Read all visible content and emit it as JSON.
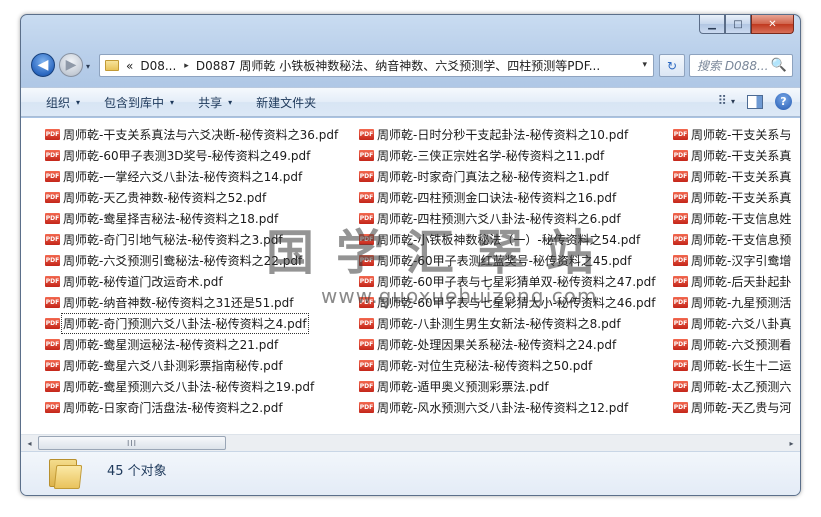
{
  "window": {
    "min_label": "▁",
    "max_label": "□",
    "close_label": "✕"
  },
  "nav": {
    "back_label": "◀",
    "fwd_label": "▶",
    "recent_label": "▾",
    "address": {
      "prefix": "«",
      "segments": [
        "D08...",
        "D0887 周师乾 小铁板神数秘法、纳音神数、六爻预测学、四柱预测等PDF..."
      ],
      "separator": "▸",
      "dropdown": "▾"
    },
    "refresh_label": "↻",
    "search_placeholder": "搜索 D088...",
    "search_icon": "🔍"
  },
  "toolbar": {
    "items": [
      {
        "label": "组织",
        "caret": "▾"
      },
      {
        "label": "包含到库中",
        "caret": "▾"
      },
      {
        "label": "共享",
        "caret": "▾"
      },
      {
        "label": "新建文件夹",
        "caret": ""
      }
    ],
    "view_icon": "⠿",
    "view_caret": "▾",
    "help_label": "?"
  },
  "files": {
    "icon_text": "PDF",
    "columns": [
      [
        "周师乾-干支关系真法与六爻决断-秘传资料之36.pdf",
        "周师乾-60甲子表测3D奖号-秘传资料之49.pdf",
        "周师乾-一掌经六爻八卦法-秘传资料之14.pdf",
        "周师乾-天乙贵神数-秘传资料之52.pdf",
        "周师乾-鸯星择吉秘法-秘传资料之18.pdf",
        "周师乾-奇门引地气秘法-秘传资料之3.pdf",
        "周师乾-六爻预测引鸯秘法-秘传资料之22.pdf",
        "周师乾-秘传道门改运奇术.pdf",
        "周师乾-纳音神数-秘传资料之31还是51.pdf",
        "周师乾-奇门预测六爻八卦法-秘传资料之4.pdf",
        "周师乾-鸯星测运秘法-秘传资料之21.pdf",
        "周师乾-鸯星六爻八卦测彩票指南秘传.pdf",
        "周师乾-鸯星预测六爻八卦法-秘传资料之19.pdf",
        "周师乾-日家奇门活盘法-秘传资料之2.pdf"
      ],
      [
        "周师乾-日时分秒干支起卦法-秘传资料之10.pdf",
        "周师乾-三侠正宗姓名学-秘传资料之11.pdf",
        "周师乾-时家奇门真法之秘-秘传资料之1.pdf",
        "周师乾-四柱预测金口诀法-秘传资料之16.pdf",
        "周师乾-四柱预测六爻八卦法-秘传资料之6.pdf",
        "周师乾-小铁板神数秘法（一）-秘传资料之54.pdf",
        "周师乾-60甲子表测红蓝奖号-秘传资料之45.pdf",
        "周师乾-60甲子表与七星彩猜单双-秘传资料之47.pdf",
        "周师乾-60甲子表与七星彩猜大小-秘传资料之46.pdf",
        "周师乾-八卦测生男生女新法-秘传资料之8.pdf",
        "周师乾-处理因果关系秘法-秘传资料之24.pdf",
        "周师乾-对位生克秘法-秘传资料之50.pdf",
        "周师乾-遁甲奥义预测彩票法.pdf",
        "周师乾-风水预测六爻八卦法-秘传资料之12.pdf"
      ],
      [
        "周师乾-干支关系与",
        "周师乾-干支关系真",
        "周师乾-干支关系真",
        "周师乾-干支关系真",
        "周师乾-干支信息姓",
        "周师乾-干支信息预",
        "周师乾-汉字引鸯增",
        "周师乾-后天卦起卦",
        "周师乾-九星预测活",
        "周师乾-六爻八卦真",
        "周师乾-六爻预测看",
        "周师乾-长生十二运",
        "周师乾-太乙预测六",
        "周师乾-天乙贵与河"
      ]
    ]
  },
  "watermark": {
    "text": "国学汇翠站",
    "url": "www.guoxuehuizong.com"
  },
  "scrollbar": {
    "left": "◂",
    "right": "▸",
    "grip": "III"
  },
  "details": {
    "count_text": "45 个对象"
  }
}
